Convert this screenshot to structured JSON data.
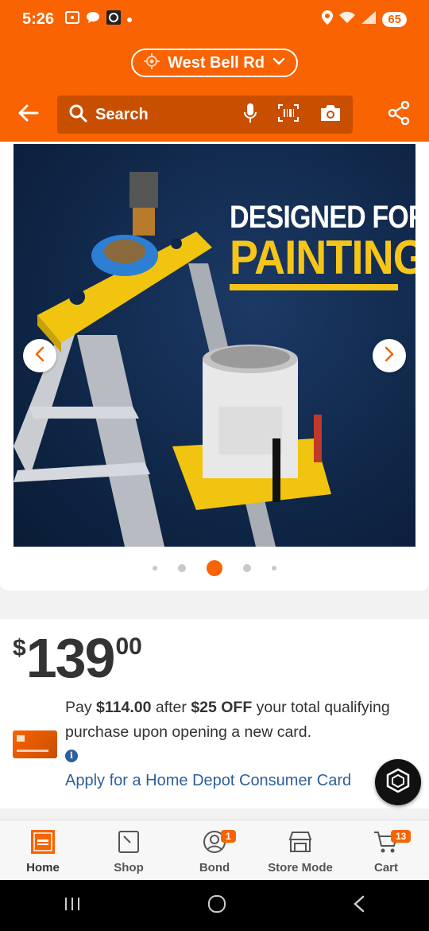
{
  "status_bar": {
    "time": "5:26",
    "battery": "65",
    "icons": [
      "screenshot-icon",
      "chat-bubble-icon",
      "app-icon",
      "location-icon",
      "wifi-icon",
      "signal-icon",
      "battery-icon"
    ]
  },
  "location": {
    "label": "West Bell Rd"
  },
  "search": {
    "placeholder": "Search"
  },
  "hero": {
    "headline_line1": "DESIGNED FOR",
    "headline_line2": "PAINTING",
    "carousel_active_index": 2,
    "carousel_count": 5
  },
  "price": {
    "currency": "$",
    "dollars": "139",
    "cents": "00"
  },
  "promo": {
    "text_pre": "Pay ",
    "amount": "$114.00",
    "text_mid": " after ",
    "discount": "$25 OFF",
    "text_post": " your total qualifying purchase upon opening a new card.",
    "link": "Apply for a Home Depot Consumer Card"
  },
  "bottom_nav": {
    "items": [
      {
        "label": "Home",
        "icon": "home-depot-logo-icon"
      },
      {
        "label": "Shop",
        "icon": "shop-icon"
      },
      {
        "label": "Bond",
        "icon": "user-icon",
        "badge": "1"
      },
      {
        "label": "Store Mode",
        "icon": "store-icon"
      },
      {
        "label": "Cart",
        "icon": "cart-icon",
        "badge": "13"
      }
    ]
  },
  "colors": {
    "brand_orange": "#f96302",
    "link_blue": "#2d5f9a",
    "headline_yellow": "#f5c518",
    "hero_bg": "#0f2647"
  }
}
